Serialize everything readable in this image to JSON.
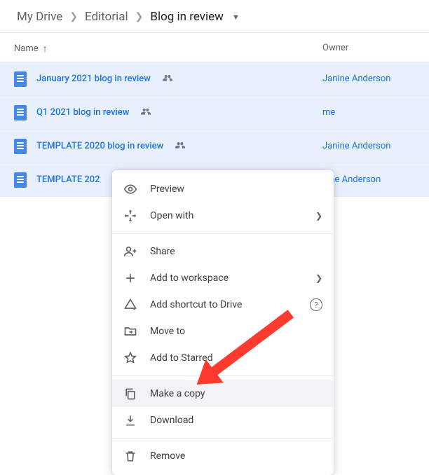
{
  "breadcrumb": {
    "items": [
      "My Drive",
      "Editorial",
      "Blog in review"
    ]
  },
  "columns": {
    "name": "Name",
    "owner": "Owner"
  },
  "files": [
    {
      "name": "January 2021 blog in review",
      "owner": "Janine Anderson"
    },
    {
      "name": "Q1 2021 blog in review",
      "owner": "me"
    },
    {
      "name": "TEMPLATE 2020 blog in review",
      "owner": "Janine Anderson"
    },
    {
      "name": "TEMPLATE 202",
      "owner": "nine Anderson"
    }
  ],
  "menu": {
    "preview": "Preview",
    "open_with": "Open with",
    "share": "Share",
    "add_workspace": "Add to workspace",
    "add_shortcut": "Add shortcut to Drive",
    "move_to": "Move to",
    "add_starred": "Add to Starred",
    "make_copy": "Make a copy",
    "download": "Download",
    "remove": "Remove"
  }
}
